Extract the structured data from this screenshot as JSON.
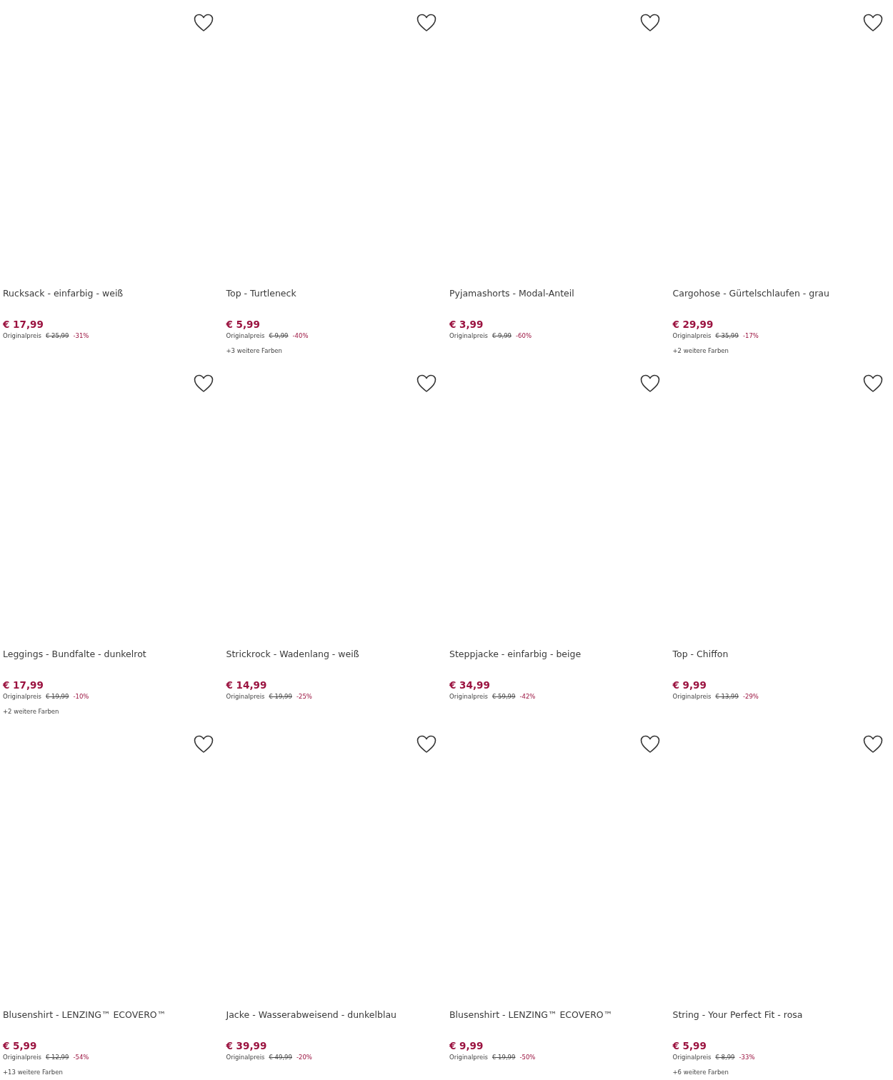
{
  "products": [
    {
      "name": "Rucksack - einfarbig - weiß",
      "price": "€ 17,99",
      "original_label": "Originalpreis",
      "original_price": "€ 25,99",
      "discount": "-31%",
      "wishlisted": false
    },
    {
      "name": "Top - Turtleneck",
      "price": "€ 5,99",
      "original_label": "Originalpreis",
      "original_price": "€ 9,99",
      "discount": "-40%",
      "more_colors": "+3 weitere Farben",
      "wishlisted": false
    },
    {
      "name": "Pyjamashorts - Modal-Anteil",
      "price": "€ 3,99",
      "original_label": "Originalpreis",
      "original_price": "€ 9,99",
      "discount": "-60%",
      "wishlisted": false
    },
    {
      "name": "Cargohose - Gürtelschlaufen - grau",
      "price": "€ 29,99",
      "original_label": "Originalpreis",
      "original_price": "€ 35,99",
      "discount": "-17%",
      "more_colors": "+2 weitere Farben",
      "wishlisted": false
    },
    {
      "name": "Leggings - Bundfalte - dunkelrot",
      "price": "€ 17,99",
      "original_label": "Originalpreis",
      "original_price": "€ 19,99",
      "discount": "-10%",
      "more_colors": "+2 weitere Farben",
      "wishlisted": false
    },
    {
      "name": "Strickrock - Wadenlang - weiß",
      "price": "€ 14,99",
      "original_label": "Originalpreis",
      "original_price": "€ 19,99",
      "discount": "-25%",
      "wishlisted": false
    },
    {
      "name": "Steppjacke - einfarbig - beige",
      "price": "€ 34,99",
      "original_label": "Originalpreis",
      "original_price": "€ 59,99",
      "discount": "-42%",
      "wishlisted": false
    },
    {
      "name": "Top - Chiffon",
      "price": "€ 9,99",
      "original_label": "Originalpreis",
      "original_price": "€ 13,99",
      "discount": "-29%",
      "wishlisted": false
    },
    {
      "name": "Blusenshirt - LENZING™ ECOVERO™",
      "price": "€ 5,99",
      "original_label": "Originalpreis",
      "original_price": "€ 12,99",
      "discount": "-54%",
      "more_colors": "+13 weitere Farben",
      "wishlisted": false
    },
    {
      "name": "Jacke - Wasserabweisend - dunkelblau",
      "price": "€ 39,99",
      "original_label": "Originalpreis",
      "original_price": "€ 49,99",
      "discount": "-20%",
      "wishlisted": false
    },
    {
      "name": "Blusenshirt - LENZING™ ECOVERO™",
      "price": "€ 9,99",
      "original_label": "Originalpreis",
      "original_price": "€ 19,99",
      "discount": "-50%",
      "wishlisted": false
    },
    {
      "name": "String - Your Perfect Fit - rosa",
      "price": "€ 5,99",
      "original_label": "Originalpreis",
      "original_price": "€ 8,99",
      "discount": "-33%",
      "more_colors": "+6 weitere Farben",
      "wishlisted": false
    }
  ]
}
